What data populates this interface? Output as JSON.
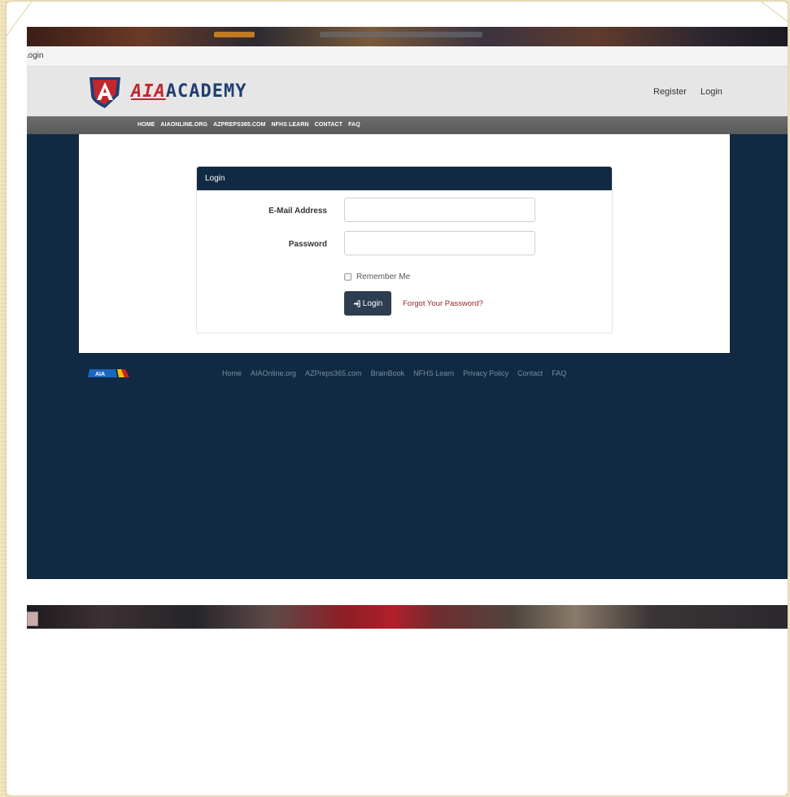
{
  "tab": {
    "title": "Login"
  },
  "header": {
    "logo_prefix": "AIA",
    "logo_suffix": "ACADEMY",
    "register_label": "Register",
    "login_label": "Login"
  },
  "nav": {
    "items": [
      "HOME",
      "AIAONLINE.ORG",
      "AZPREPS365.COM",
      "NFHS LEARN",
      "CONTACT",
      "FAQ"
    ]
  },
  "login_form": {
    "panel_title": "Login",
    "email_label": "E-Mail Address",
    "email_value": "",
    "password_label": "Password",
    "password_value": "",
    "remember_label": "Remember Me",
    "submit_label": "Login",
    "forgot_label": "Forgot Your Password?"
  },
  "footer": {
    "logo_text": "AIA",
    "links": [
      "Home",
      "AIAOnline.org",
      "AZPreps365.com",
      "BrainBook",
      "NFHS Learn",
      "Privacy Policy",
      "Contact",
      "FAQ"
    ]
  },
  "colors": {
    "navy": "#0f2a42",
    "button": "#2c3e50",
    "logo_red": "#c1272d",
    "logo_blue": "#1f3f73",
    "forgot_link": "#9b2226"
  },
  "icons": {
    "login_button": "sign-in-icon",
    "logo": "shield-a-icon"
  }
}
